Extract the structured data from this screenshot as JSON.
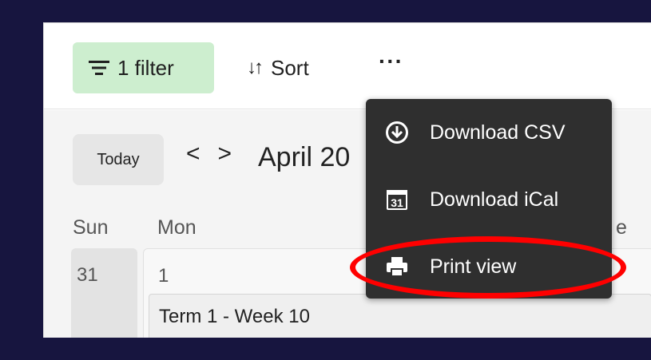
{
  "toolbar": {
    "filter_label": "1 filter",
    "sort_label": "Sort",
    "more_label": "···"
  },
  "calendar": {
    "today_label": "Today",
    "prev_label": "<",
    "next_label": ">",
    "month_label": "April 20",
    "weekdays": {
      "sun": "Sun",
      "mon": "Mon",
      "tue_partial": "e"
    },
    "days": {
      "sun": "31",
      "mon": "1"
    },
    "event": "Term 1 - Week 10"
  },
  "menu": {
    "items": [
      {
        "label": "Download CSV",
        "icon": "download-icon"
      },
      {
        "label": "Download iCal",
        "icon": "calendar-icon",
        "icon_text": "31"
      },
      {
        "label": "Print view",
        "icon": "printer-icon"
      }
    ]
  },
  "colors": {
    "background": "#17153f",
    "filter_active": "#cdeecf",
    "menu_bg": "#2f2f2f",
    "highlight": "#ff0000"
  }
}
